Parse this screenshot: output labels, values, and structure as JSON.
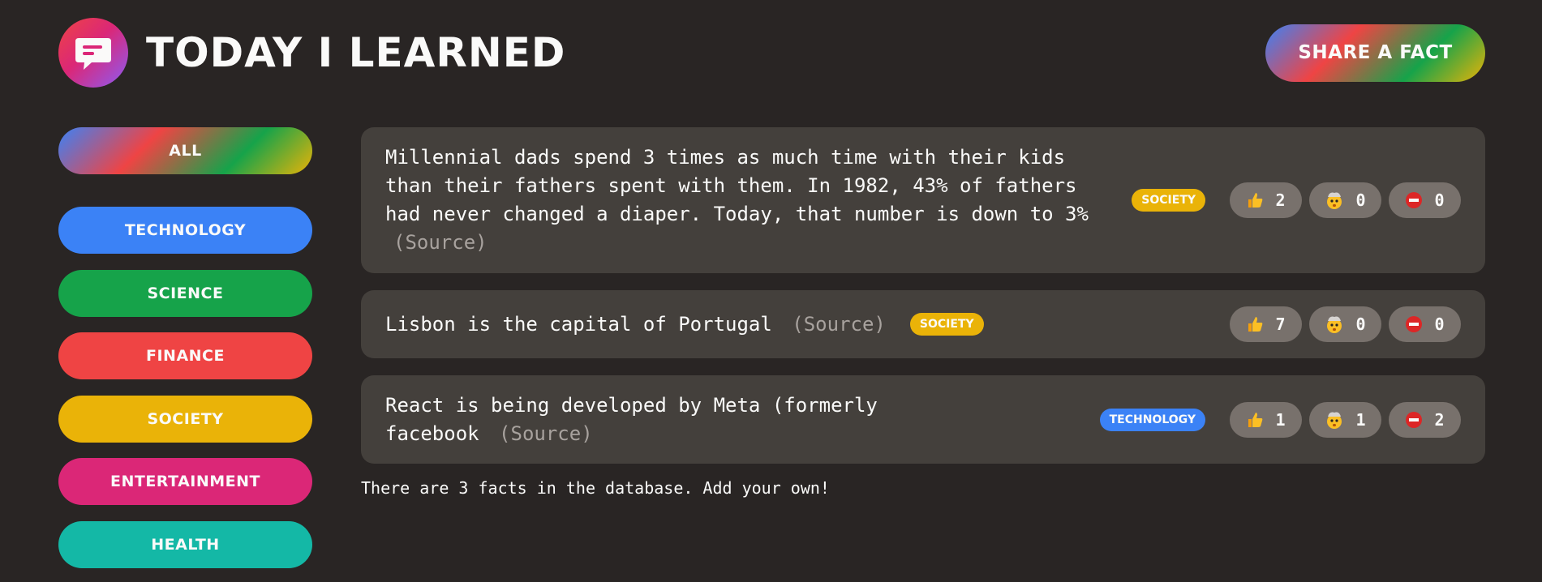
{
  "header": {
    "title": "Today I Learned",
    "share_label": "Share a fact",
    "logo_icon": "message-bubble-icon"
  },
  "sidebar": {
    "all_label": "All",
    "categories": [
      {
        "label": "Technology",
        "color": "#3b82f6"
      },
      {
        "label": "Science",
        "color": "#16a34a"
      },
      {
        "label": "Finance",
        "color": "#ef4444"
      },
      {
        "label": "Society",
        "color": "#eab308"
      },
      {
        "label": "Entertainment",
        "color": "#db2777"
      },
      {
        "label": "Health",
        "color": "#14b8a6"
      }
    ]
  },
  "facts": [
    {
      "text": "Millennial dads spend 3 times as much time with their kids than their fathers spent with them. In 1982, 43% of fathers had never changed a diaper. Today, that number is down to 3%",
      "source_label": "(Source)",
      "category": "Society",
      "category_color": "#eab308",
      "votes": {
        "interesting": "2",
        "mindblowing": "0",
        "false": "0"
      }
    },
    {
      "text": "Lisbon is the capital of Portugal",
      "source_label": "(Source)",
      "category": "Society",
      "category_color": "#eab308",
      "votes": {
        "interesting": "7",
        "mindblowing": "0",
        "false": "0"
      }
    },
    {
      "text": "React is being developed by Meta (formerly facebook",
      "source_label": "(Source)",
      "category": "Technology",
      "category_color": "#3b82f6",
      "votes": {
        "interesting": "1",
        "mindblowing": "1",
        "false": "2"
      }
    }
  ],
  "footer": {
    "text": "There are 3 facts in the database. Add your own!"
  },
  "icons": {
    "interesting": "thumbs-up-icon",
    "mindblowing": "exploding-head-icon",
    "false": "no-entry-icon"
  }
}
